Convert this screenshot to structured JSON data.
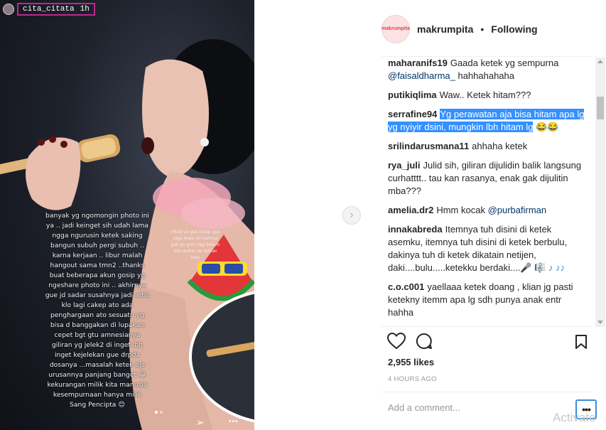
{
  "story": {
    "username": "cita_citata",
    "time": "1h",
    "caption": "banyak yg ngomongin photo ini ya .. jadi keinget sih udah lama ngga ngurusin ketek saking bangun subuh pergi subuh .. karna kerjaan .. libur malah hangout sama tmn2 ..thanks buat beberapa akun gosip yg ngeshare photo ini .. akhirnya gue jd sadar susahnya jadi artis klo lagi cakep ato ada penghargaan ato sesuatu yg bisa d banggakan di lupakan cepet bgt gtu amnesianya giliran yg jelek2 di inget lbh inget kejelekan gue drpda dosanya ...masalah ketek aja urusannya panjang banget 😂 kekurangan milik kita manusia kesempurnaan hanya milik Sang Pencipta 😊",
    "sticker_text": "mksd ya gue tutup gue juga malu sih liatnya gak ya gmn lagi belum ada waktu ke dokter tsay"
  },
  "post": {
    "account": "makrumpita",
    "separator": "•",
    "follow_state": "Following",
    "avatar_label": "makrumpita",
    "comments": [
      {
        "user": "maharanifs19",
        "parts": [
          {
            "t": "Gaada ketek yg sempurna "
          },
          {
            "t": "@faisaldharma_",
            "k": "mention"
          },
          {
            "t": " hahhahahaha"
          }
        ]
      },
      {
        "user": "putikiqlima",
        "parts": [
          {
            "t": "Waw.. Ketek hitam???"
          }
        ]
      },
      {
        "user": "serrafine94",
        "parts": [
          {
            "t": "Yg perawatan aja bisa hitam apa lg yg nyiyir dsini, mungkin lbh hitam lg",
            "k": "hl"
          },
          {
            "t": " 😂😂"
          }
        ]
      },
      {
        "user": "srilindarusmana11",
        "parts": [
          {
            "t": "ahhaha ketek"
          }
        ]
      },
      {
        "user": "rya_juli",
        "parts": [
          {
            "t": "Julid sih, giliran dijulidin balik langsung curhatttt.. tau kan rasanya, enak gak dijulitin mba???"
          }
        ]
      },
      {
        "user": "amelia.dr2",
        "parts": [
          {
            "t": "Hmm kocak "
          },
          {
            "t": "@purbafirman",
            "k": "mention"
          }
        ]
      },
      {
        "user": "innakabreda",
        "parts": [
          {
            "t": "Itemnya tuh disini di ketek asemku, itemnya tuh disini di ketek berbulu, dakinya tuh di ketek dikatain netijen, daki....bulu.....ketekku berdaki....🎤 "
          },
          {
            "t": "🎼 ♪ ♪♪",
            "k": "note"
          }
        ]
      },
      {
        "user": "c.o.c001",
        "parts": [
          {
            "t": "yaellaaa ketek doang , klian jg pasti ketekny itemm apa lg sdh punya anak entr hahha"
          }
        ]
      }
    ],
    "likes": "2,955 likes",
    "time_ago": "4 HOURS AGO",
    "add_comment_placeholder": "Add a comment...",
    "more_label": "•••",
    "watermark": "Activate"
  },
  "icons": {
    "like": "heart-icon",
    "comment": "comment-icon",
    "save": "bookmark-icon",
    "next": "chevron-right-icon",
    "share": "send-icon"
  }
}
